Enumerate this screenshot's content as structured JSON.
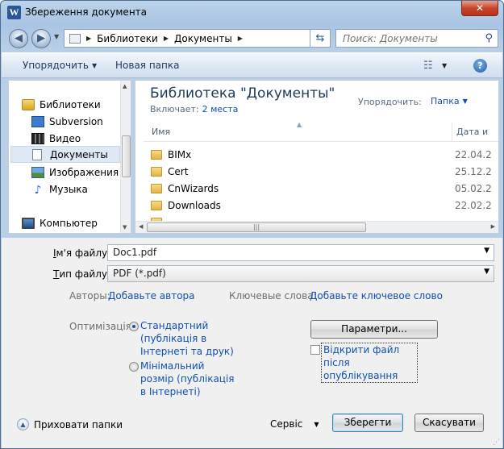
{
  "window": {
    "title": "Збереження документа",
    "app_icon": "W",
    "close": "✕"
  },
  "address": {
    "crumbs": [
      "Библиотеки",
      "Документы"
    ],
    "search_placeholder": "Поиск: Документы"
  },
  "toolbar": {
    "organize": "Упорядочить",
    "new_folder": "Новая папка",
    "help": "?"
  },
  "nav": {
    "items": [
      {
        "label": "Библиотеки",
        "icon": "library-icon"
      },
      {
        "label": "Subversion",
        "icon": "subversion-icon"
      },
      {
        "label": "Видео",
        "icon": "video-icon"
      },
      {
        "label": "Документы",
        "icon": "documents-icon",
        "selected": true
      },
      {
        "label": "Изображения",
        "icon": "images-icon"
      },
      {
        "label": "Музыка",
        "icon": "music-icon"
      },
      {
        "label": "Компьютер",
        "icon": "computer-icon"
      }
    ]
  },
  "content": {
    "title": "Библиотека \"Документы\"",
    "includes_label": "Включает:",
    "includes_link": "2 места",
    "arrange_label": "Упорядочить:",
    "arrange_value": "Папка",
    "columns": {
      "name": "Имя",
      "date": "Дата и"
    },
    "files": [
      {
        "name": "BIMx",
        "date": "22.04.2"
      },
      {
        "name": "Cert",
        "date": "25.12.2"
      },
      {
        "name": "CnWizards",
        "date": "05.02.2"
      },
      {
        "name": "Downloads",
        "date": "22.02.2"
      }
    ]
  },
  "form": {
    "filename_label_accel": "І",
    "filename_label_rest": "м'я файлу:",
    "filename_value": "Doc1.pdf",
    "type_label_accel": "Т",
    "type_label_rest": "ип файлу:",
    "type_value": "PDF (*.pdf)",
    "authors_label": "Авторы:",
    "authors_link": "Добавьте автора",
    "keywords_label": "Ключевые слова:",
    "keywords_link": "Добавьте ключевое слово",
    "optimize_label": "Оптимізація:",
    "opt_standard": "Стандартний (публікація в Інтернеті та друк)",
    "opt_minimal": "Мінімальний розмір (публікація в Інтернеті)",
    "options_button": "Параметри...",
    "open_after": "Відкрити файл після опублікування"
  },
  "footer": {
    "hide_folders": "Приховати папки",
    "service": "Сервіс",
    "save": "Зберегти",
    "cancel": "Скасувати"
  }
}
